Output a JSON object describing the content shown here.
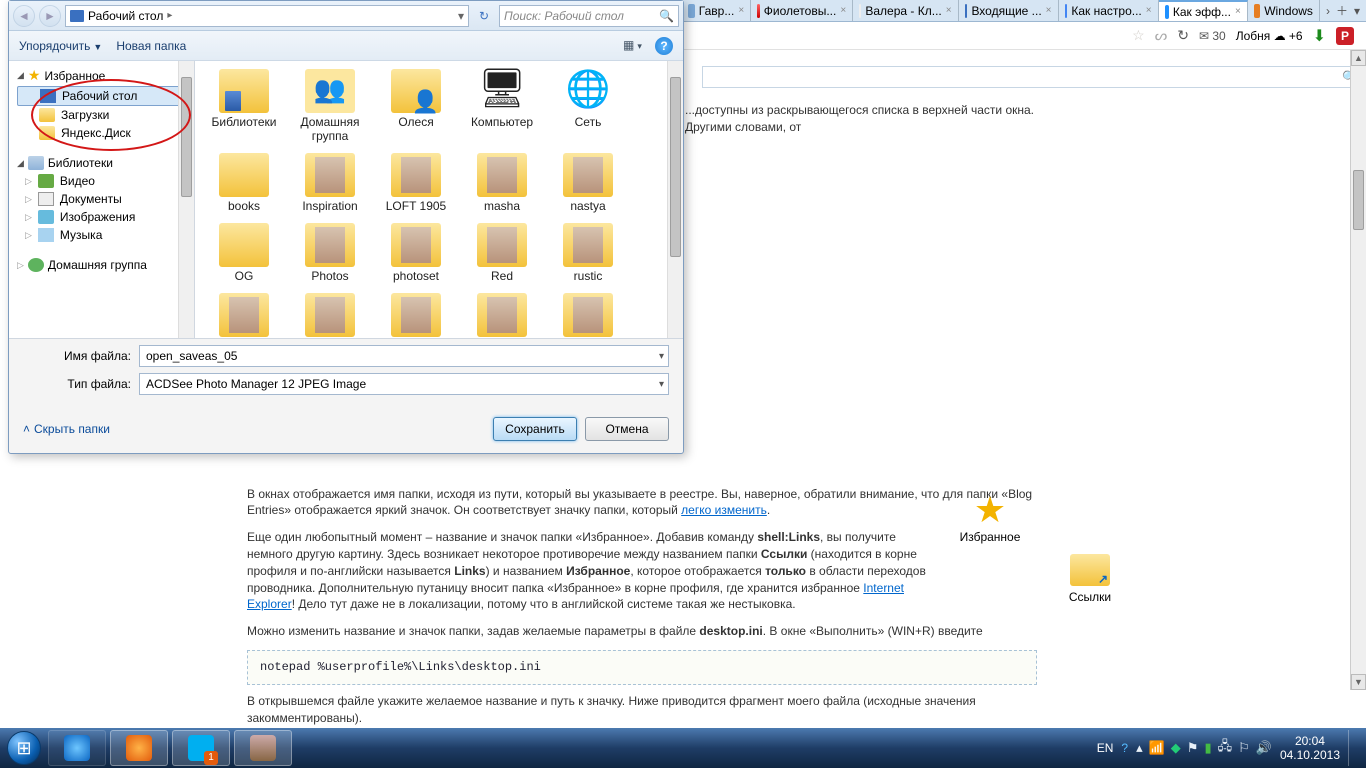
{
  "browser": {
    "tabs": [
      {
        "label": "Гавр..."
      },
      {
        "label": "Фиолетовы..."
      },
      {
        "label": "Валера - Кл..."
      },
      {
        "label": "Входящие ..."
      },
      {
        "label": "Как настро..."
      },
      {
        "label": "Как эфф...",
        "active": true
      },
      {
        "label": "Windows"
      }
    ],
    "mail_count": "30",
    "weather_city": "Лобня",
    "weather_temp": "+6"
  },
  "dialog": {
    "breadcrumb": "Рабочий стол",
    "search_placeholder": "Поиск: Рабочий стол",
    "organize": "Упорядочить",
    "new_folder": "Новая папка",
    "nav": {
      "favorites": "Избранное",
      "desktop": "Рабочий стол",
      "downloads": "Загрузки",
      "yadisk": "Яндекс.Диск",
      "libraries": "Библиотеки",
      "video": "Видео",
      "documents": "Документы",
      "images": "Изображения",
      "music": "Музыка",
      "homegroup": "Домашняя группа"
    },
    "items": [
      {
        "label": "Библиотеки",
        "cls": "f-lib"
      },
      {
        "label": "Домашняя группа",
        "cls": "f-people"
      },
      {
        "label": "Олеся",
        "cls": "f-userfolder"
      },
      {
        "label": "Компьютер",
        "cls": "f-computer"
      },
      {
        "label": "Сеть",
        "cls": "f-network"
      },
      {
        "label": "books",
        "cls": "f-folder"
      },
      {
        "label": "Inspiration",
        "cls": "f-thumb"
      },
      {
        "label": "LOFT 1905",
        "cls": "f-thumb"
      },
      {
        "label": "masha",
        "cls": "f-thumb"
      },
      {
        "label": "nastya",
        "cls": "f-thumb"
      },
      {
        "label": "OG",
        "cls": "f-folder"
      },
      {
        "label": "Photos",
        "cls": "f-thumb"
      },
      {
        "label": "photoset",
        "cls": "f-thumb"
      },
      {
        "label": "Red",
        "cls": "f-thumb"
      },
      {
        "label": "rustic",
        "cls": "f-thumb"
      },
      {
        "label": "",
        "cls": "f-thumb"
      },
      {
        "label": "",
        "cls": "f-thumb"
      },
      {
        "label": "",
        "cls": "f-thumb"
      },
      {
        "label": "",
        "cls": "f-thumb"
      },
      {
        "label": "",
        "cls": "f-thumb"
      }
    ],
    "filename_label": "Имя файла:",
    "filename_value": "open_saveas_05",
    "filetype_label": "Тип файла:",
    "filetype_value": "ACDSee Photo Manager 12 JPEG Image",
    "hide_folders": "Скрыть папки",
    "save": "Сохранить",
    "cancel": "Отмена"
  },
  "article": {
    "line1": "...доступны из раскрывающегося списка в верхней части окна. Другими словами, от",
    "blog_p": "В окнах отображается имя папки, исходя из пути, который вы указываете в реестре. Вы, наверное, обратили внимание, что для папки «Blog Entries» отображается яркий значок. Он соответствует значку папки, который ",
    "link_change": "легко изменить",
    "p3_a": "Еще один любопытный момент – название и значок папки «Избранное». Добавив команду ",
    "shell_links": "shell:Links",
    "p3_b": ", вы получите немного другую картину. Здесь возникает некоторое противоречие между названием папки ",
    "links_b": "Ссылки",
    "p3_c": " (находится в корне профиля и по-английски называется ",
    "links_en": "Links",
    "p3_d": ") и названием ",
    "fav_b": "Избранное",
    "p3_e": ", которое отображается ",
    "only_b": "только",
    "p3_f": " в области переходов проводника. Дополнительную путаницу вносит папка «Избранное» в корне профиля, где хранится избранное ",
    "ie_link": "Internet Explorer",
    "p3_g": "! Дело тут даже не в локализации, потому что в английской системе такая же нестыковка.",
    "p4_a": "Можно изменить название и значок папки, задав желаемые параметры в файле ",
    "desktop_ini": "desktop.ini",
    "p4_b": ". В окне «Выполнить» (WIN+R) введите",
    "code": "notepad %userprofile%\\Links\\desktop.ini",
    "p5": "В открывшемся файле укажите желаемое название и путь к значку. Ниже приводится фрагмент моего файла (исходные значения закомментированы).",
    "aside_fav": "Избранное",
    "aside_links": "Ссылки"
  },
  "taskbar": {
    "lang": "EN",
    "time": "20:04",
    "date": "04.10.2013"
  }
}
